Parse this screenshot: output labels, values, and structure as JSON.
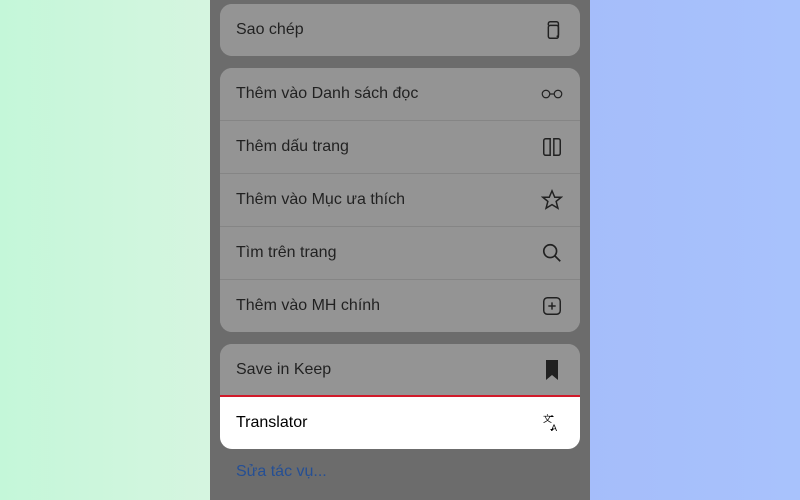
{
  "menu": {
    "group1": [
      {
        "label": "Sao chép",
        "icon": "copy-icon"
      }
    ],
    "group2": [
      {
        "label": "Thêm vào Danh sách đọc",
        "icon": "glasses-icon"
      },
      {
        "label": "Thêm dấu trang",
        "icon": "book-icon"
      },
      {
        "label": "Thêm vào Mục ưa thích",
        "icon": "star-icon"
      },
      {
        "label": "Tìm trên trang",
        "icon": "search-icon"
      },
      {
        "label": "Thêm vào MH chính",
        "icon": "plus-square-icon"
      }
    ],
    "group3": [
      {
        "label": "Save in Keep",
        "icon": "bookmark-filled-icon"
      },
      {
        "label": "Translator",
        "icon": "translate-icon",
        "highlighted": true
      }
    ],
    "edit_actions": "Sửa tác vụ..."
  }
}
